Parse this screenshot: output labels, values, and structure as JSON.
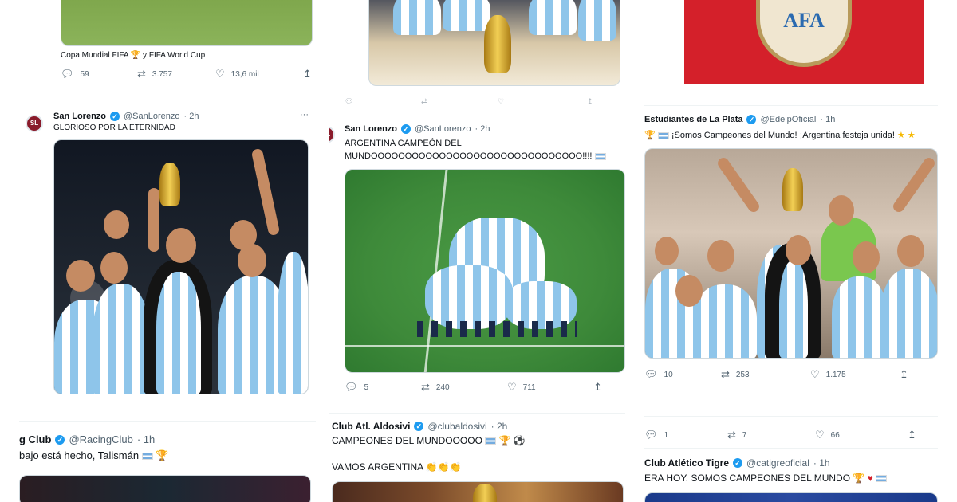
{
  "col1_top": {
    "caption": "Copa Mundial FIFA 🏆 y FIFA World Cup",
    "replies": "59",
    "retweets": "3.757",
    "likes": "13,6 mil"
  },
  "col1_main": {
    "name": "San Lorenzo",
    "handle": "@SanLorenzo",
    "time": "· 2h",
    "text": "GLORIOSO POR LA ETERNIDAD",
    "more": "···"
  },
  "col1_bottom": {
    "name": "g Club",
    "handle": "@RacingClub",
    "time": "· 1h",
    "text": "bajo está hecho, Talismán"
  },
  "col2_main": {
    "name": "San Lorenzo",
    "handle": "@SanLorenzo",
    "time": "· 2h",
    "text_line1": "ARGENTINA CAMPEÓN DEL",
    "text_line2": "MUNDOOOOOOOOOOOOOOOOOOOOOOOOOOOOOOO!!!!",
    "replies": "5",
    "retweets": "240",
    "likes": "711"
  },
  "col2_bottom": {
    "name": "Club Atl. Aldosivi",
    "handle": "@clubaldosivi",
    "time": "· 2h",
    "text_line1": "CAMPEONES DEL MUNDOOOOO",
    "text_line2": "VAMOS ARGENTINA"
  },
  "col3_top": {
    "logo_text": "AFA"
  },
  "col3_main": {
    "name": "Estudiantes de La Plata",
    "handle": "@EdelpOficial",
    "time": "· 1h",
    "text": "¡Somos Campeones del Mundo! ¡Argentina festeja unida!",
    "replies": "10",
    "retweets": "253",
    "likes": "1.175"
  },
  "col3_stub": {
    "replies": "1",
    "retweets": "7",
    "likes": "66"
  },
  "col3_bottom": {
    "name": "Club Atlético Tigre",
    "handle": "@catigreoficial",
    "time": "· 1h",
    "text": "ERA HOY. SOMOS CAMPEONES DEL MUNDO"
  },
  "icons": {
    "reply": "reply-icon",
    "retweet": "retweet-icon",
    "like": "heart-icon",
    "share": "share-icon",
    "verified": "verified-badge-icon",
    "trophy": "trophy-emoji",
    "flag": "argentina-flag-emoji"
  },
  "colors": {
    "verified": "#1d9bf0",
    "muted": "#536471",
    "afa_red": "#d4202a",
    "pitch": "#3e8a3a"
  }
}
